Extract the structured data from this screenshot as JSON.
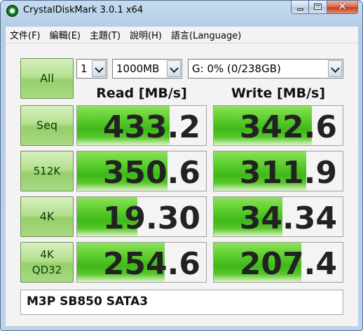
{
  "window": {
    "title": "CrystalDiskMark 3.0.1 x64"
  },
  "menu": [
    "文件(F)",
    "編輯(E)",
    "主題(T)",
    "說明(H)",
    "語言(Language)"
  ],
  "controls": {
    "all_label": "All",
    "runs": "1",
    "size": "1000MB",
    "drive": "G: 0% (0/238GB)"
  },
  "headers": {
    "read": "Read [MB/s]",
    "write": "Write [MB/s]"
  },
  "rows": [
    {
      "label": "Seq",
      "read": "433.2",
      "write": "342.6",
      "read_level": 0.72,
      "write_level": 0.76
    },
    {
      "label": "512K",
      "read": "350.6",
      "write": "311.9",
      "read_level": 0.7,
      "write_level": 0.72
    },
    {
      "label": "4K",
      "read": "19.30",
      "write": "34.34",
      "read_level": 0.47,
      "write_level": 0.53
    },
    {
      "label": "4K\nQD32",
      "read": "254.6",
      "write": "207.4",
      "read_level": 0.68,
      "write_level": 0.68
    }
  ],
  "comment": "M3P SB850 SATA3",
  "colors": {
    "bar_green": "#4cc41f",
    "button_green": "#a9d985",
    "frame_blue": "#b9d1ea"
  }
}
